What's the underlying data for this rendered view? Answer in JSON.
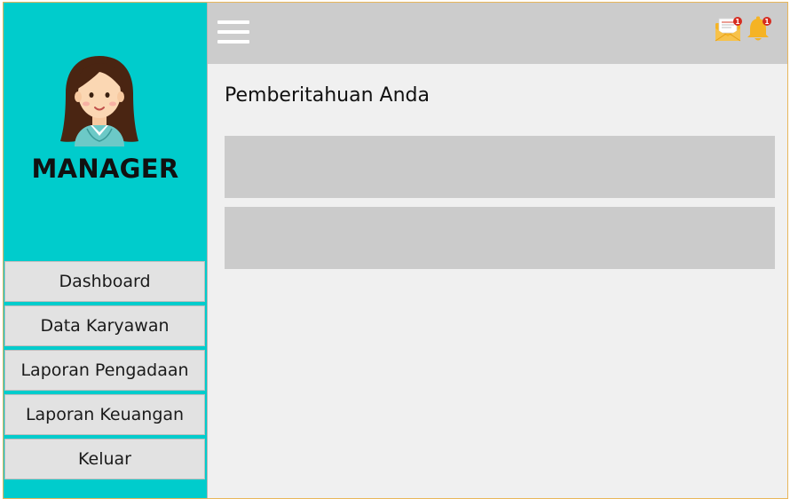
{
  "sidebar": {
    "role": "MANAGER",
    "avatar_icon": "woman-avatar-icon",
    "menu": [
      {
        "label": "Dashboard"
      },
      {
        "label": "Data Karyawan"
      },
      {
        "label": "Laporan Pengadaan"
      },
      {
        "label": "Laporan Keuangan"
      },
      {
        "label": "Keluar"
      }
    ]
  },
  "topbar": {
    "menu_icon": "hamburger-menu-icon",
    "mail_icon": "mail-icon",
    "mail_badge": "1",
    "bell_icon": "bell-icon",
    "bell_badge": "1"
  },
  "main": {
    "title": "Pemberitahuan Anda",
    "notifications": [
      {
        "text": ""
      },
      {
        "text": ""
      }
    ]
  },
  "colors": {
    "sidebar_bg": "#00cccc",
    "topbar_bg": "#cccccc",
    "content_bg": "#f0f0f0",
    "menu_item_bg": "#e2e2e2",
    "notification_bg": "#cbcbcb",
    "badge_red": "#d62b1f",
    "icon_yellow": "#f5b324"
  }
}
